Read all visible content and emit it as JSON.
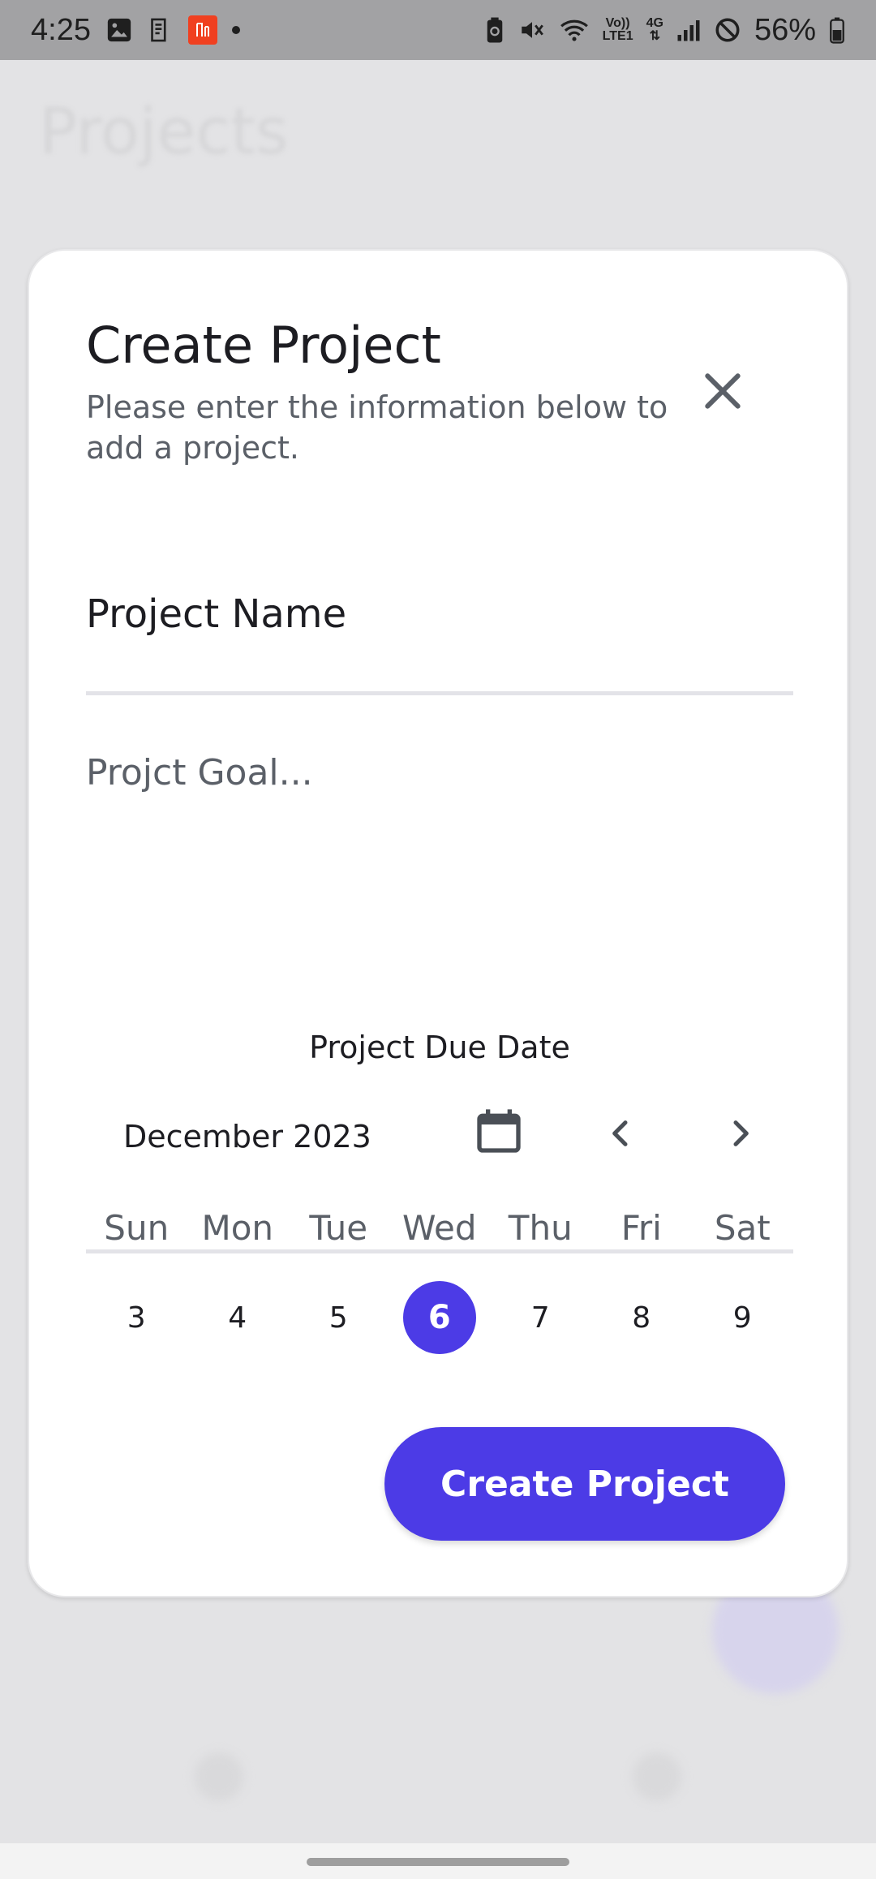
{
  "status_bar": {
    "time": "4:25",
    "network_small_top": "Vo))",
    "network_small_bottom": "LTE1",
    "network_type": "4G",
    "battery": "56%"
  },
  "background": {
    "title": "Projects"
  },
  "dialog": {
    "title": "Create Project",
    "subtitle": "Please enter the information below to add a project.",
    "project_name_value": "Project Name",
    "goal_placeholder": "Projct Goal...",
    "due_date_label": "Project Due Date",
    "month_label": "December 2023",
    "weekdays": [
      "Sun",
      "Mon",
      "Tue",
      "Wed",
      "Thu",
      "Fri",
      "Sat"
    ],
    "days": [
      "3",
      "4",
      "5",
      "6",
      "7",
      "8",
      "9"
    ],
    "selected_day": "6",
    "create_button": "Create Project"
  },
  "colors": {
    "accent": "#4c3be6",
    "overlay": "#e3e3e5",
    "muted_text": "#5b6068"
  },
  "icons": [
    "close-icon",
    "calendar-icon",
    "chevron-left-icon",
    "chevron-right-icon"
  ]
}
